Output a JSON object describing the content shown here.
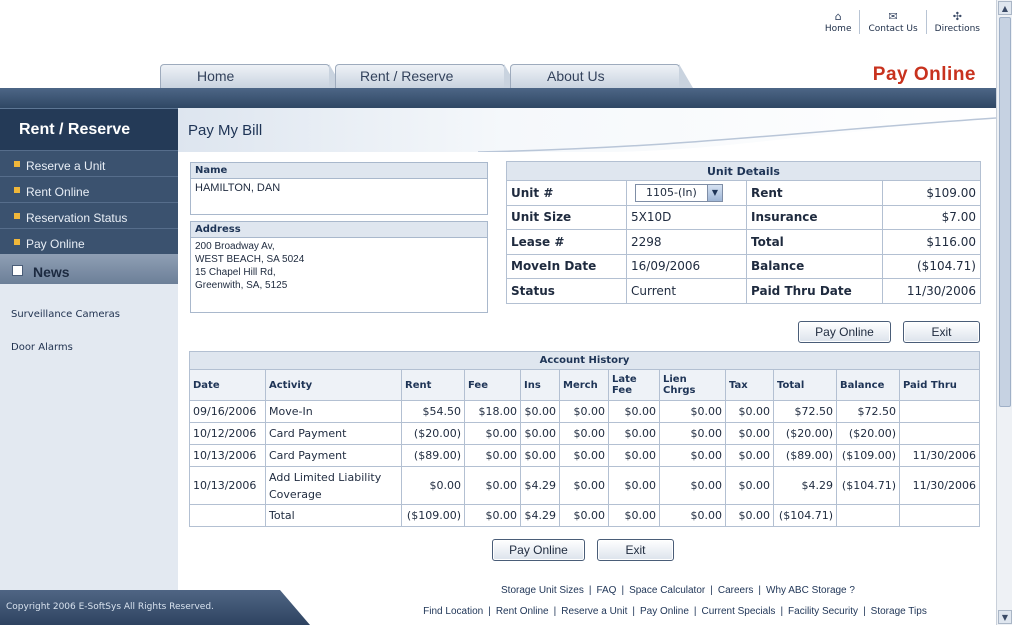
{
  "header": {
    "toplinks": [
      {
        "label": "Home",
        "icon": "home-icon",
        "glyph": "⌂"
      },
      {
        "label": "Contact Us",
        "icon": "mail-icon",
        "glyph": "✉"
      },
      {
        "label": "Directions",
        "icon": "compass-icon",
        "glyph": "✣"
      }
    ],
    "tabs": [
      "Home",
      "Rent / Reserve",
      "About Us"
    ],
    "pay_online_title": "Pay Online"
  },
  "sidebar": {
    "heading": "Rent / Reserve",
    "items": [
      "Reserve a Unit",
      "Rent Online",
      "Reservation Status",
      "Pay Online"
    ],
    "news_label": "News",
    "links": [
      "Surveillance Cameras",
      "Door Alarms"
    ],
    "copyright": "Copyright 2006 E-SoftSys All Rights Reserved."
  },
  "main": {
    "title": "Pay My Bill",
    "name_label": "Name",
    "name_value": "HAMILTON, DAN",
    "address_label": "Address",
    "address_lines": [
      "200 Broadway Av,",
      "WEST BEACH, SA 5024",
      "15 Chapel Hill Rd,",
      "Greenwith, SA, 5125"
    ]
  },
  "unit_details": {
    "title": "Unit Details",
    "unit_label": "Unit #",
    "unit_selected": "1105-(In)",
    "size_label": "Unit Size",
    "size_value": "5X10D",
    "lease_label": "Lease #",
    "lease_value": "2298",
    "movein_label": "MoveIn Date",
    "movein_value": "16/09/2006",
    "status_label": "Status",
    "status_value": "Current",
    "rent_label": "Rent",
    "rent_value": "$109.00",
    "insurance_label": "Insurance",
    "insurance_value": "$7.00",
    "total_label": "Total",
    "total_value": "$116.00",
    "balance_label": "Balance",
    "balance_value": "($104.71)",
    "paidthru_label": "Paid Thru Date",
    "paidthru_value": "11/30/2006"
  },
  "buttons": {
    "pay_online": "Pay Online",
    "exit": "Exit"
  },
  "history": {
    "title": "Account History",
    "columns": [
      "Date",
      "Activity",
      "Rent",
      "Fee",
      "Ins",
      "Merch",
      "Late Fee",
      "Lien Chrgs",
      "Tax",
      "Total",
      "Balance",
      "Paid Thru"
    ],
    "rows": [
      [
        "09/16/2006",
        "Move-In",
        "$54.50",
        "$18.00",
        "$0.00",
        "$0.00",
        "$0.00",
        "$0.00",
        "$0.00",
        "$72.50",
        "$72.50",
        ""
      ],
      [
        "10/12/2006",
        "Card Payment",
        "($20.00)",
        "$0.00",
        "$0.00",
        "$0.00",
        "$0.00",
        "$0.00",
        "$0.00",
        "($20.00)",
        "($20.00)",
        ""
      ],
      [
        "10/13/2006",
        "Card Payment",
        "($89.00)",
        "$0.00",
        "$0.00",
        "$0.00",
        "$0.00",
        "$0.00",
        "$0.00",
        "($89.00)",
        "($109.00)",
        "11/30/2006"
      ],
      [
        "10/13/2006",
        "Add Limited Liability Coverage",
        "$0.00",
        "$0.00",
        "$4.29",
        "$0.00",
        "$0.00",
        "$0.00",
        "$0.00",
        "$4.29",
        "($104.71)",
        "11/30/2006"
      ],
      [
        "",
        "Total",
        "($109.00)",
        "$0.00",
        "$4.29",
        "$0.00",
        "$0.00",
        "$0.00",
        "$0.00",
        "($104.71)",
        "",
        ""
      ]
    ]
  },
  "footer": {
    "links_row1": [
      "Storage Unit Sizes",
      "FAQ",
      "Space Calculator",
      "Careers",
      "Why ABC Storage ?"
    ],
    "links_row2": [
      "Find Location",
      "Rent Online",
      "Reserve a Unit",
      "Pay Online",
      "Current Specials",
      "Facility Security",
      "Storage Tips"
    ]
  },
  "colors": {
    "navy": "#243a57",
    "accent_red": "#c8321e",
    "bullet": "#f0b73a"
  }
}
